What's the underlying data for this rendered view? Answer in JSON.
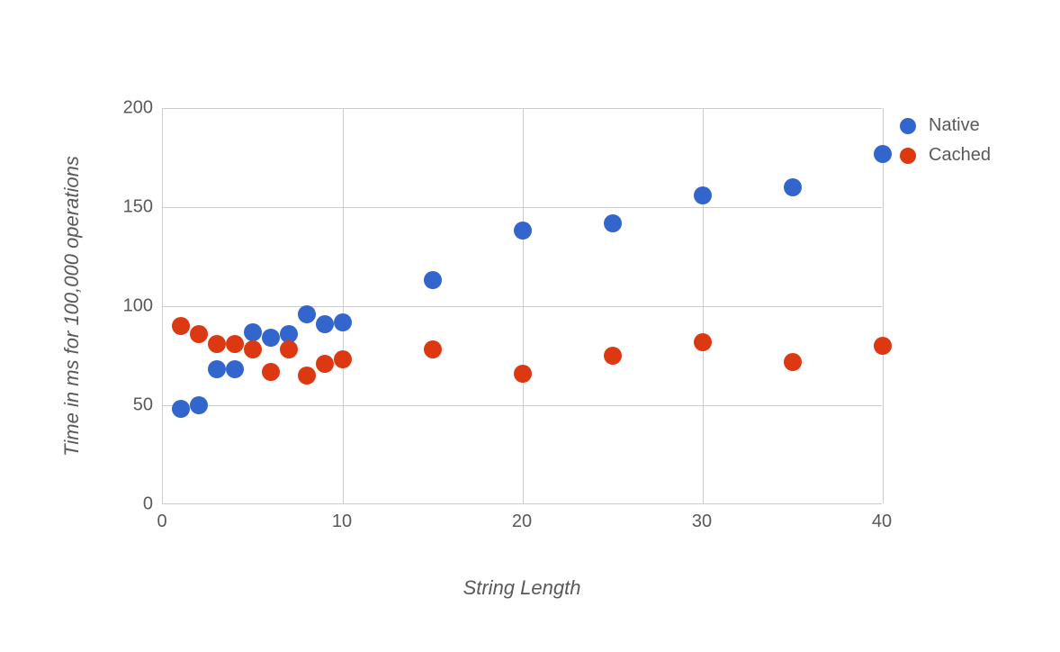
{
  "chart_data": {
    "type": "scatter",
    "xlabel": "String Length",
    "ylabel": "Time in ms for 100,000 operations",
    "xlim": [
      0,
      40
    ],
    "ylim": [
      0,
      200
    ],
    "xticks": [
      0,
      10,
      20,
      30,
      40
    ],
    "yticks": [
      0,
      50,
      100,
      150,
      200
    ],
    "legend_position": "right",
    "grid": true,
    "series": [
      {
        "name": "Native",
        "color": "#3366cc",
        "points": [
          {
            "x": 1,
            "y": 48
          },
          {
            "x": 2,
            "y": 50
          },
          {
            "x": 3,
            "y": 68
          },
          {
            "x": 4,
            "y": 68
          },
          {
            "x": 5,
            "y": 87
          },
          {
            "x": 6,
            "y": 84
          },
          {
            "x": 7,
            "y": 86
          },
          {
            "x": 8,
            "y": 96
          },
          {
            "x": 9,
            "y": 91
          },
          {
            "x": 10,
            "y": 92
          },
          {
            "x": 15,
            "y": 113
          },
          {
            "x": 20,
            "y": 138
          },
          {
            "x": 25,
            "y": 142
          },
          {
            "x": 30,
            "y": 156
          },
          {
            "x": 35,
            "y": 160
          },
          {
            "x": 40,
            "y": 177
          }
        ]
      },
      {
        "name": "Cached",
        "color": "#dc3912",
        "points": [
          {
            "x": 1,
            "y": 90
          },
          {
            "x": 2,
            "y": 86
          },
          {
            "x": 3,
            "y": 81
          },
          {
            "x": 4,
            "y": 81
          },
          {
            "x": 5,
            "y": 78
          },
          {
            "x": 6,
            "y": 67
          },
          {
            "x": 7,
            "y": 78
          },
          {
            "x": 8,
            "y": 65
          },
          {
            "x": 9,
            "y": 71
          },
          {
            "x": 10,
            "y": 73
          },
          {
            "x": 15,
            "y": 78
          },
          {
            "x": 20,
            "y": 66
          },
          {
            "x": 25,
            "y": 75
          },
          {
            "x": 30,
            "y": 82
          },
          {
            "x": 35,
            "y": 72
          },
          {
            "x": 40,
            "y": 80
          }
        ]
      }
    ]
  }
}
